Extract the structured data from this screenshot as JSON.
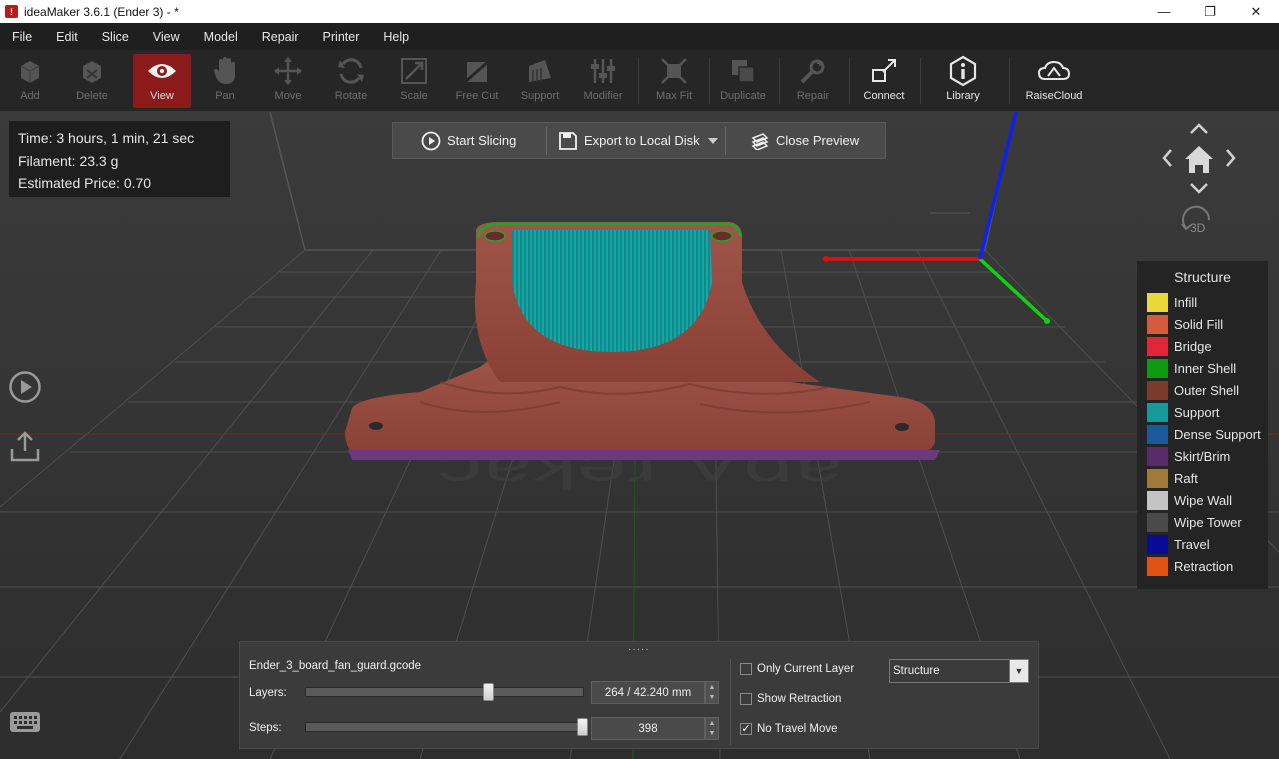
{
  "window": {
    "title": "ideaMaker 3.6.1 (Ender 3) - *",
    "logo_glyph": "!"
  },
  "window_controls": [
    "—",
    "❐",
    "✕"
  ],
  "menu": [
    "File",
    "Edit",
    "Slice",
    "View",
    "Model",
    "Repair",
    "Printer",
    "Help"
  ],
  "toolbar": {
    "add": "Add",
    "delete": "Delete",
    "view": "View",
    "pan": "Pan",
    "move": "Move",
    "rotate": "Rotate",
    "scale": "Scale",
    "free_cut": "Free Cut",
    "support": "Support",
    "modifier": "Modifier",
    "max_fit": "Max Fit",
    "duplicate": "Duplicate",
    "repair": "Repair",
    "connect": "Connect",
    "library": "Library",
    "raisecloud": "RaiseCloud"
  },
  "stats": {
    "time": "Time: 3 hours, 1 min, 21 sec",
    "filament": "Filament: 23.3 g",
    "price": "Estimated Price: 0.70"
  },
  "slicebar": {
    "start_slicing": "Start Slicing",
    "export": "Export to Local Disk",
    "close_preview": "Close Preview"
  },
  "navcube": {
    "mode_3d": "3D"
  },
  "legend": {
    "title": "Structure",
    "items": [
      {
        "label": "Infill",
        "color": "#e8d83a"
      },
      {
        "label": "Solid Fill",
        "color": "#d25c3c"
      },
      {
        "label": "Bridge",
        "color": "#e3253a"
      },
      {
        "label": "Inner Shell",
        "color": "#109a14"
      },
      {
        "label": "Outer Shell",
        "color": "#7a3a2c"
      },
      {
        "label": "Support",
        "color": "#169a9a"
      },
      {
        "label": "Dense Support",
        "color": "#1a5a9a"
      },
      {
        "label": "Skirt/Brim",
        "color": "#5a2a6a"
      },
      {
        "label": "Raft",
        "color": "#a07a3a"
      },
      {
        "label": "Wipe Wall",
        "color": "#c4c4c4"
      },
      {
        "label": "Wipe Tower",
        "color": "#4a4a4a"
      },
      {
        "label": "Travel",
        "color": "#0a0a96"
      },
      {
        "label": "Retraction",
        "color": "#e05214"
      }
    ]
  },
  "preview": {
    "filename": "Ender_3_board_fan_guard.gcode",
    "layers_label": "Layers:",
    "layers_value": "264 / 42.240 mm",
    "layers_fraction": 0.66,
    "steps_label": "Steps:",
    "steps_value": "398",
    "steps_fraction": 1.0,
    "only_current_layer": "Only Current Layer",
    "only_current_layer_checked": false,
    "show_retraction": "Show Retraction",
    "show_retraction_checked": false,
    "no_travel_move": "No Travel Move",
    "no_travel_move_checked": true,
    "color_mode": "Structure",
    "grip": "·····"
  },
  "colors": {
    "accent_active": "#8b1a1a",
    "axis_x": "#e01010",
    "axis_y": "#10d010",
    "axis_z": "#1020f0"
  }
}
